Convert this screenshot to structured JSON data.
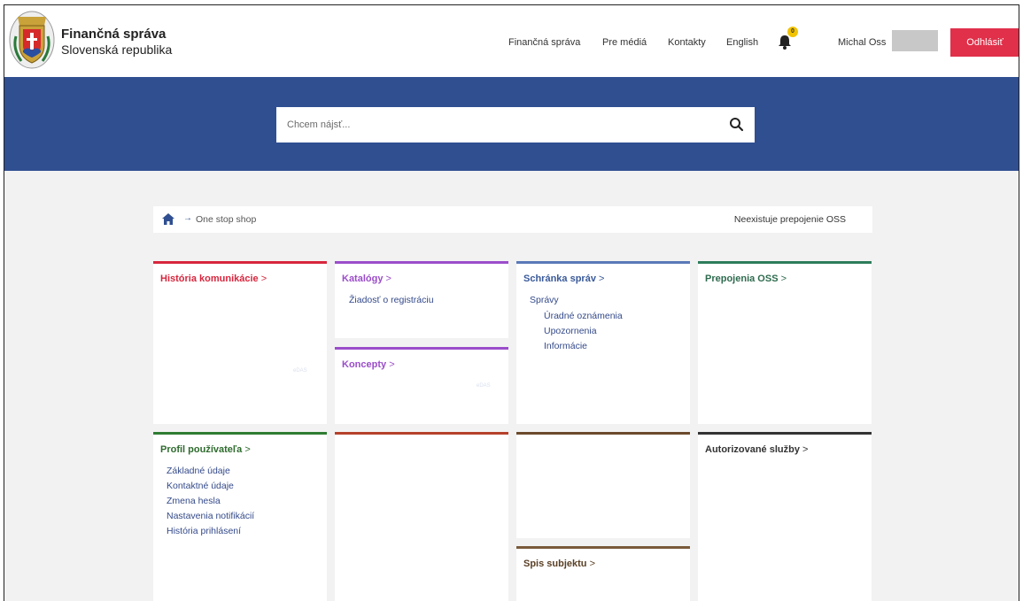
{
  "header": {
    "brand_title": "Finančná správa",
    "brand_subtitle": "Slovenská republika",
    "nav": [
      "Finančná správa",
      "Pre médiá",
      "Kontakty",
      "English"
    ],
    "notification_count": "0",
    "user_name": "Michal Oss",
    "logout_label": "Odhlásiť"
  },
  "search": {
    "placeholder": "Chcem nájsť..."
  },
  "breadcrumb": {
    "arrow": "→",
    "current": "One stop shop",
    "status": "Neexistuje prepojenie OSS"
  },
  "tiles": {
    "historia": {
      "title": "História komunikácie",
      "gt": ">",
      "faint": "eDAS",
      "color": "#d7263d"
    },
    "katalogy": {
      "title": "Katalógy",
      "gt": ">",
      "links": [
        "Žiadosť o registráciu"
      ],
      "color": "#9b4dca"
    },
    "koncepty": {
      "title": "Koncepty",
      "gt": ">",
      "faint": "eDAS",
      "color": "#9b4dca"
    },
    "schranka": {
      "title": "Schránka správ",
      "gt": ">",
      "color": "#5a79b8",
      "group": "Správy",
      "links": [
        "Úradné oznámenia",
        "Upozornenia",
        "Informácie"
      ]
    },
    "prepojenia": {
      "title": "Prepojenia OSS",
      "gt": ">",
      "color": "#2e7d5b"
    },
    "profil": {
      "title": "Profil používateľa",
      "gt": ">",
      "color": "#2e7d32",
      "links": [
        "Základné údaje",
        "Kontaktné údaje",
        "Zmena hesla",
        "Nastavenia notifikácií",
        "História prihlásení"
      ]
    },
    "empty_red": {
      "color": "#b5412b"
    },
    "empty_brown": {
      "color": "#6b4a2b"
    },
    "spis": {
      "title": "Spis subjektu",
      "gt": ">",
      "color": "#7a5a3a"
    },
    "autorizovane": {
      "title": "Autorizované služby",
      "gt": ">",
      "color": "#333333"
    }
  }
}
